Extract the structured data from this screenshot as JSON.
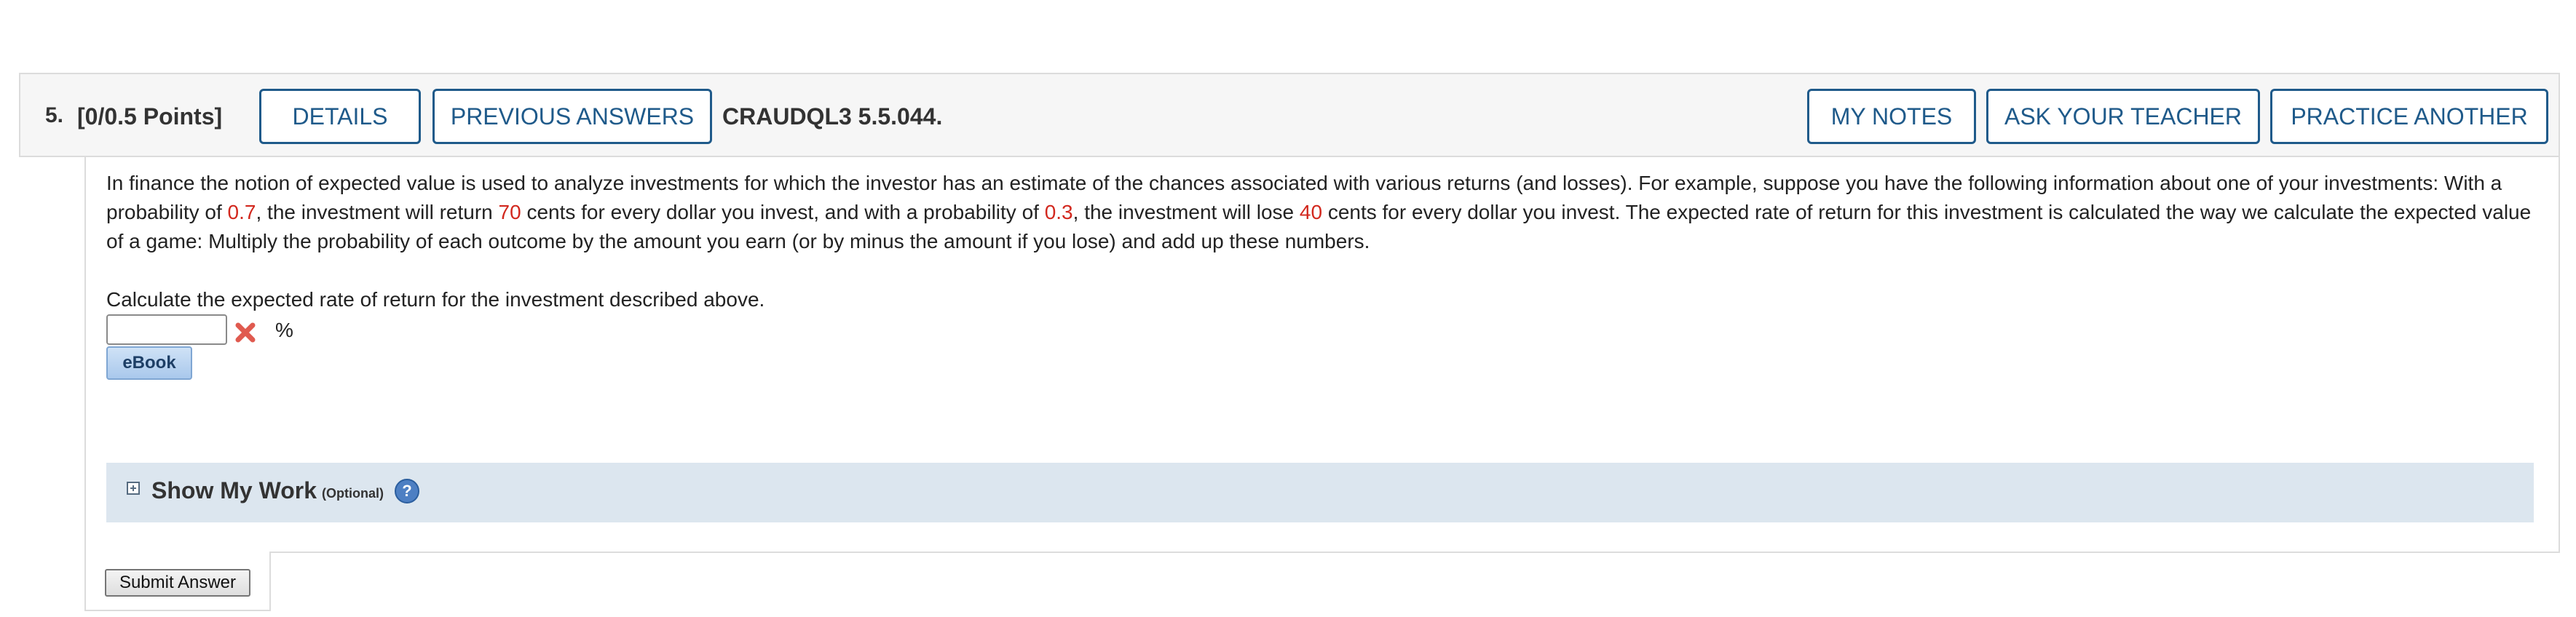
{
  "question": {
    "number": "5.",
    "points": "[0/0.5 Points]",
    "code": "CRAUDQL3 5.5.044."
  },
  "header_buttons": {
    "details": "DETAILS",
    "previous_answers": "PREVIOUS ANSWERS",
    "my_notes": "MY NOTES",
    "ask_your_teacher": "ASK YOUR TEACHER",
    "practice_another": "PRACTICE ANOTHER"
  },
  "body": {
    "para_1": "In finance the notion of expected value is used to analyze investments for which the investor has an estimate of the chances associated with various returns (and losses). For example, suppose you have the following information about one of your investments: With a probability of ",
    "prob_win": "0.7",
    "para_2": ", the investment will return ",
    "return_cents": "70",
    "para_3": " cents for every dollar you invest, and with a probability of ",
    "prob_lose": "0.3",
    "para_4": ", the investment will lose ",
    "loss_cents": "40",
    "para_5": " cents for every dollar you invest. The expected rate of return for this investment is calculated the way we calculate the expected value of a game: Multiply the probability of each outcome by the amount you earn (or by minus the amount if you lose) and add up these numbers.",
    "prompt": "Calculate the expected rate of return for the investment described above.",
    "answer_value": "",
    "unit": "%",
    "answer_status_icon": "incorrect-x-icon",
    "ebook_label": "eBook"
  },
  "show_my_work": {
    "title": "Show My Work",
    "optional": "(Optional)",
    "help_glyph": "?",
    "icon": "expand-plus-icon"
  },
  "submit_label": "Submit Answer",
  "colors": {
    "accent": "#1f5a8a",
    "highlight_red": "#d2281e",
    "show_work_bg": "#dce6ef",
    "x_icon": "#e05a4f"
  }
}
